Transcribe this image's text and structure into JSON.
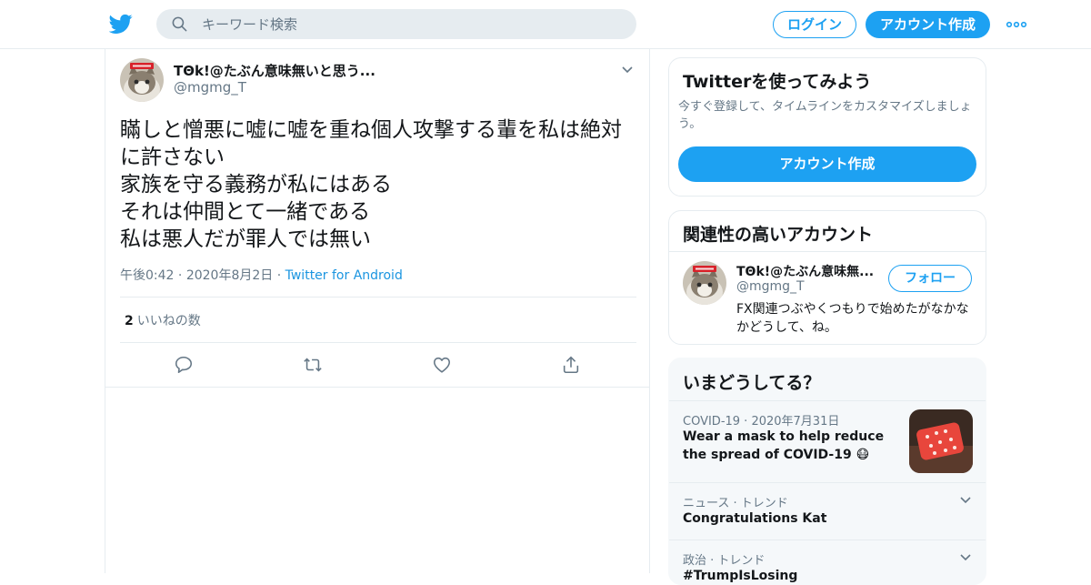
{
  "header": {
    "search_placeholder": "キーワード検索",
    "login_label": "ログイン",
    "signup_label": "アカウント作成"
  },
  "tweet": {
    "display_name": "TΘk!@たぶん意味無いと思う...",
    "handle": "@mgmg_T",
    "text": "瞞しと憎悪に嘘に嘘を重ね個人攻撃する輩を私は絶対に許さない\n家族を守る義務が私にはある\nそれは仲間とて一緒である\n私は悪人だが罪人では無い",
    "time": "午後0:42",
    "date": "2020年8月2日",
    "source": "Twitter for Android",
    "likes_count": "2",
    "likes_label": "いいねの数"
  },
  "sidebar": {
    "signup_card": {
      "title": "Twitterを使ってみよう",
      "subtitle": "今すぐ登録して、タイムラインをカスタマイズしましょう。",
      "button": "アカウント作成"
    },
    "related": {
      "title": "関連性の高いアカウント",
      "name": "TΘk!@たぶん意味無...",
      "handle": "@mgmg_T",
      "follow_label": "フォロー",
      "bio": "FX関連つぶやくつもりで始めたがなかなかどうして、ね。"
    },
    "trends": {
      "title": "いまどうしてる？",
      "items": [
        {
          "category": "COVID-19 · 2020年7月31日",
          "headline": "Wear a mask to help reduce the spread of COVID-19 😷"
        },
        {
          "category": "ニュース · トレンド",
          "headline": "Congratulations Kat"
        },
        {
          "category": "政治 · トレンド",
          "headline": "#TrumpIsLosing"
        }
      ]
    }
  },
  "colors": {
    "accent": "#1da1f2",
    "secondary_text": "#657786",
    "divider": "#e6ecf0"
  }
}
